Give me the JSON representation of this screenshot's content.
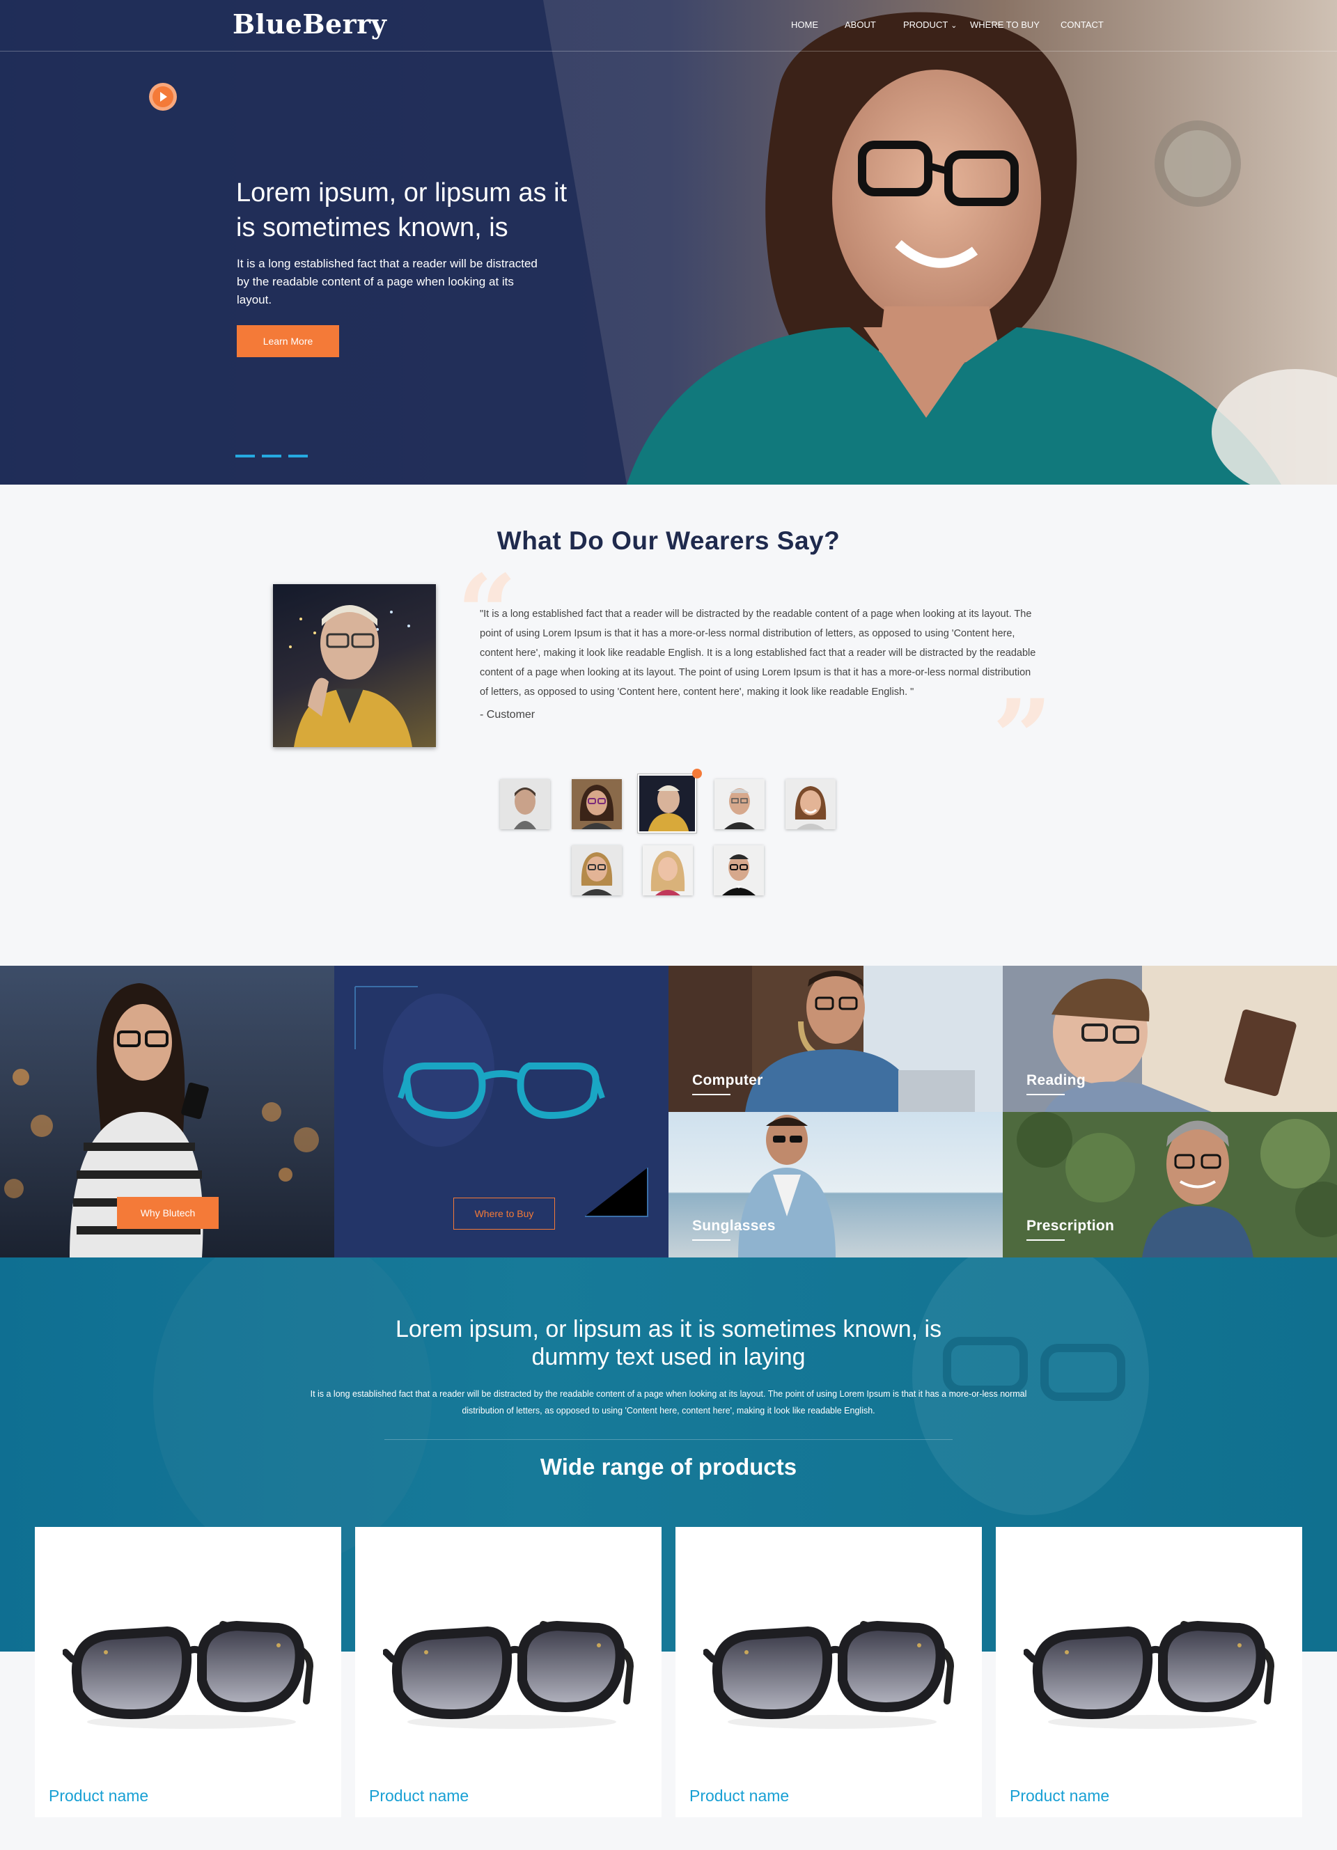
{
  "brand": {
    "logo": "BlueBerry"
  },
  "nav": {
    "home": "HOME",
    "about": "ABOUT",
    "product": "PRODUCT",
    "where": "WHERE TO BUY",
    "contact": "CONTACT"
  },
  "hero": {
    "title": "Lorem ipsum, or lipsum as it is sometimes known, is",
    "subtitle": "It is a long established fact that a reader will be distracted by the readable content of a page when looking at its layout.",
    "button": "Learn More",
    "slide_count": 3
  },
  "testimonials": {
    "title": "What Do Our Wearers Say?",
    "quote": "\"It is a long established fact that a reader will be distracted by the readable content of a page when looking at its layout. The point of using Lorem Ipsum is that it has a more-or-less normal distribution of letters, as opposed to using 'Content here, content here', making it look like readable English. It is a long established fact that a reader will be distracted by the readable content of a page when looking at its layout. The point of using Lorem Ipsum is that it has a more-or-less normal distribution of letters, as opposed to using 'Content here, content here', making it look like readable English. \"",
    "author": "- Customer",
    "avatar_count": 8,
    "active_avatar": 3
  },
  "tiles": {
    "why_button": "Why Blutech",
    "where_button": "Where to Buy",
    "computer": "Computer",
    "reading": "Reading",
    "sunglasses": "Sunglasses",
    "prescription": "Prescription"
  },
  "promo": {
    "title_line1": "Lorem ipsum, or lipsum as it is sometimes known, is",
    "title_line2": "dummy text used in laying",
    "text": "It is a long established fact that a reader will be distracted by the readable content of a page when looking at its layout. The point of using Lorem Ipsum is that it has a more-or-less normal distribution of letters, as opposed to using 'Content here, content here', making it look like readable English.",
    "products_title": "Wide range of products"
  },
  "products": [
    {
      "name": "Product name"
    },
    {
      "name": "Product name"
    },
    {
      "name": "Product name"
    },
    {
      "name": "Product name"
    }
  ],
  "colors": {
    "accent": "#f47a38",
    "navy": "#1f2a4d",
    "teal": "#10708f",
    "link": "#19a0d4",
    "slider": "#26a9e0"
  }
}
